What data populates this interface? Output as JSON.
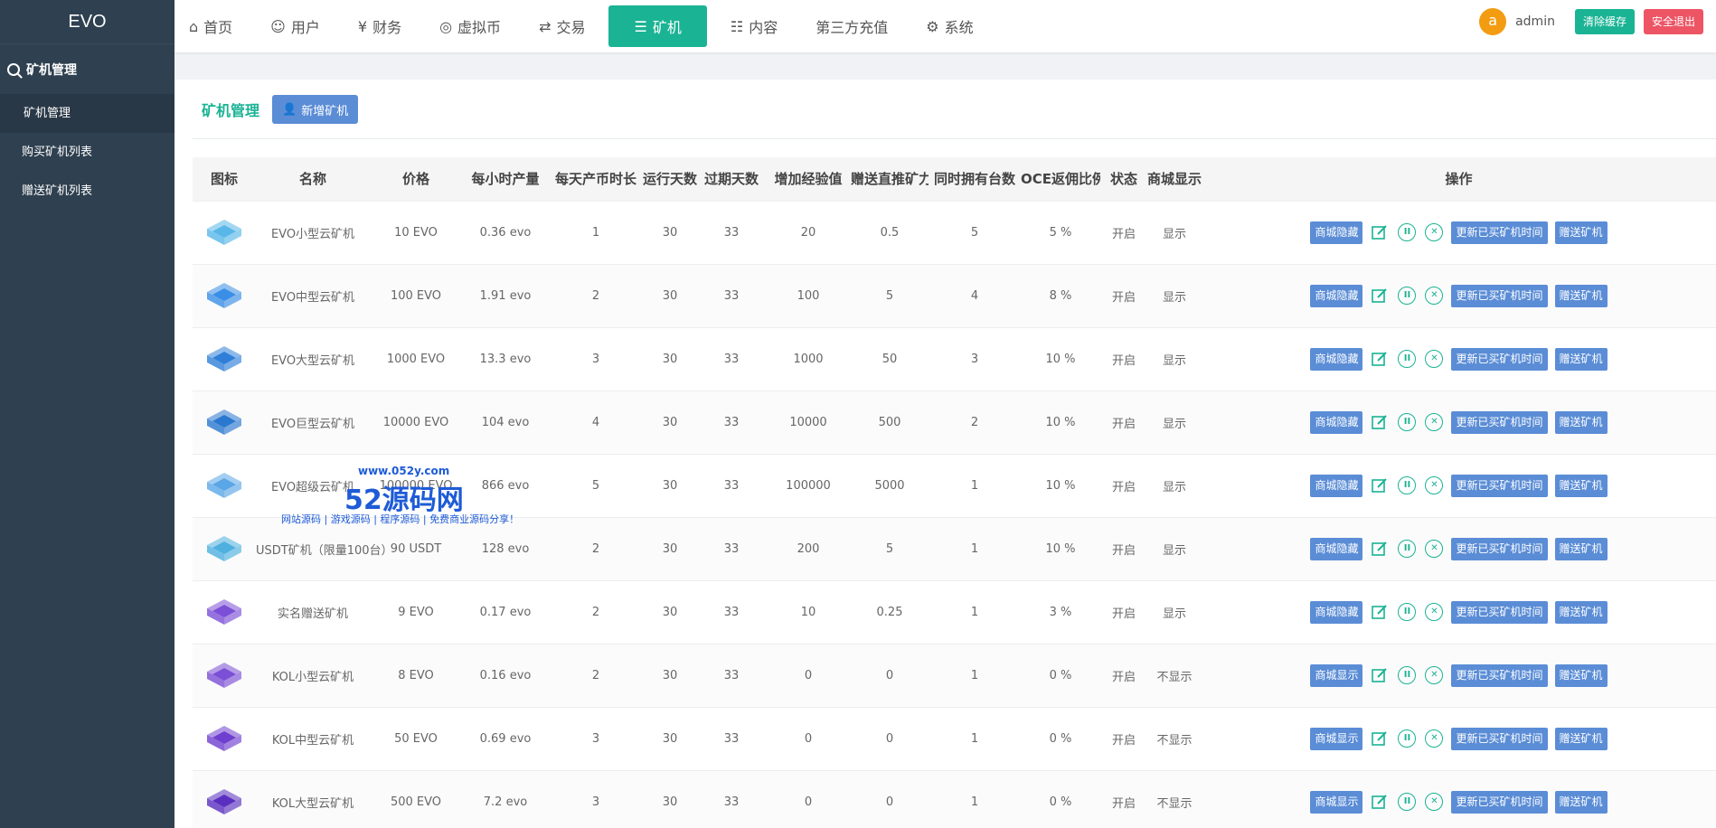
{
  "sidebar": {
    "logo": "EVO",
    "section_title": "矿机管理",
    "items": [
      {
        "label": "矿机管理"
      },
      {
        "label": "购买矿机列表"
      },
      {
        "label": "赠送矿机列表"
      }
    ]
  },
  "nav": {
    "items": [
      {
        "icon": "home-icon",
        "label": "首页"
      },
      {
        "icon": "user-icon",
        "label": "用户"
      },
      {
        "icon": "money-icon",
        "label": "财务"
      },
      {
        "icon": "coins-icon",
        "label": "虚拟币"
      },
      {
        "icon": "exchange-icon",
        "label": "交易"
      },
      {
        "icon": "server-icon",
        "label": "矿机"
      },
      {
        "icon": "document-icon",
        "label": "内容"
      },
      {
        "icon": "",
        "label": "第三方充值"
      },
      {
        "icon": "gear-icon",
        "label": "系统"
      }
    ],
    "active_index": 5,
    "avatar_letter": "a",
    "username": "admin",
    "clear_cache": "清除缓存",
    "logout": "安全退出"
  },
  "page": {
    "title": "矿机管理",
    "add_button": "新增矿机"
  },
  "table": {
    "headers": [
      "图标",
      "名称",
      "价格",
      "每小时产量",
      "每天产币时长",
      "运行天数",
      "过期天数",
      "增加经验值",
      "赠送直推矿力",
      "同时拥有台数",
      "OCE返佣比例",
      "状态",
      "商城显示",
      "操作"
    ],
    "action_labels": {
      "update_time": "更新已买矿机时间",
      "gift": "赠送矿机"
    },
    "rows": [
      {
        "name": "EVO小型云矿机",
        "price": "10 EVO",
        "hourly": "0.36 evo",
        "daily_hours": "1",
        "run_days": "30",
        "expire_days": "33",
        "exp": "20",
        "power": "0.5",
        "max_count": "5",
        "ratio": "5 %",
        "status": "开启",
        "shop": "显示",
        "toggle": "商城隐藏",
        "icon_color": "#58b7e8"
      },
      {
        "name": "EVO中型云矿机",
        "price": "100 EVO",
        "hourly": "1.91 evo",
        "daily_hours": "2",
        "run_days": "30",
        "expire_days": "33",
        "exp": "100",
        "power": "5",
        "max_count": "4",
        "ratio": "8 %",
        "status": "开启",
        "shop": "显示",
        "toggle": "商城隐藏",
        "icon_color": "#3a8ee6"
      },
      {
        "name": "EVO大型云矿机",
        "price": "1000 EVO",
        "hourly": "13.3 evo",
        "daily_hours": "3",
        "run_days": "30",
        "expire_days": "33",
        "exp": "1000",
        "power": "50",
        "max_count": "3",
        "ratio": "10 %",
        "status": "开启",
        "shop": "显示",
        "toggle": "商城隐藏",
        "icon_color": "#2f7fd8"
      },
      {
        "name": "EVO巨型云矿机",
        "price": "10000 EVO",
        "hourly": "104 evo",
        "daily_hours": "4",
        "run_days": "30",
        "expire_days": "33",
        "exp": "10000",
        "power": "500",
        "max_count": "2",
        "ratio": "10 %",
        "status": "开启",
        "shop": "显示",
        "toggle": "商城隐藏",
        "icon_color": "#2a78d0"
      },
      {
        "name": "EVO超级云矿机",
        "price": "100000 EVO",
        "hourly": "866 evo",
        "daily_hours": "5",
        "run_days": "30",
        "expire_days": "33",
        "exp": "100000",
        "power": "5000",
        "max_count": "1",
        "ratio": "10 %",
        "status": "开启",
        "shop": "显示",
        "toggle": "商城隐藏",
        "icon_color": "#5aa6e6"
      },
      {
        "name": "USDT矿机（限量100台）",
        "price": "90 USDT",
        "hourly": "128 evo",
        "daily_hours": "2",
        "run_days": "30",
        "expire_days": "33",
        "exp": "200",
        "power": "5",
        "max_count": "1",
        "ratio": "10 %",
        "status": "开启",
        "shop": "显示",
        "toggle": "商城隐藏",
        "icon_color": "#4fb0e0"
      },
      {
        "name": "实名赠送矿机",
        "price": "9 EVO",
        "hourly": "0.17 evo",
        "daily_hours": "2",
        "run_days": "30",
        "expire_days": "33",
        "exp": "10",
        "power": "0.25",
        "max_count": "1",
        "ratio": "3 %",
        "status": "开启",
        "shop": "显示",
        "toggle": "商城隐藏",
        "icon_color": "#7b4fd6"
      },
      {
        "name": "KOL小型云矿机",
        "price": "8 EVO",
        "hourly": "0.16 evo",
        "daily_hours": "2",
        "run_days": "30",
        "expire_days": "33",
        "exp": "0",
        "power": "0",
        "max_count": "1",
        "ratio": "0 %",
        "status": "开启",
        "shop": "不显示",
        "toggle": "商城显示",
        "icon_color": "#7b4fd6"
      },
      {
        "name": "KOL中型云矿机",
        "price": "50 EVO",
        "hourly": "0.69 evo",
        "daily_hours": "3",
        "run_days": "30",
        "expire_days": "33",
        "exp": "0",
        "power": "0",
        "max_count": "1",
        "ratio": "0 %",
        "status": "开启",
        "shop": "不显示",
        "toggle": "商城显示",
        "icon_color": "#6f3fcf"
      },
      {
        "name": "KOL大型云矿机",
        "price": "500 EVO",
        "hourly": "7.2 evo",
        "daily_hours": "3",
        "run_days": "30",
        "expire_days": "33",
        "exp": "0",
        "power": "0",
        "max_count": "1",
        "ratio": "0 %",
        "status": "开启",
        "shop": "不显示",
        "toggle": "商城显示",
        "icon_color": "#5a2fc0"
      }
    ]
  },
  "watermark": {
    "site": "www.052y.com",
    "brand": "52源码网",
    "slogan": "网站源码 | 游戏源码 | 程序源码 | 免费商业源码分享！"
  }
}
